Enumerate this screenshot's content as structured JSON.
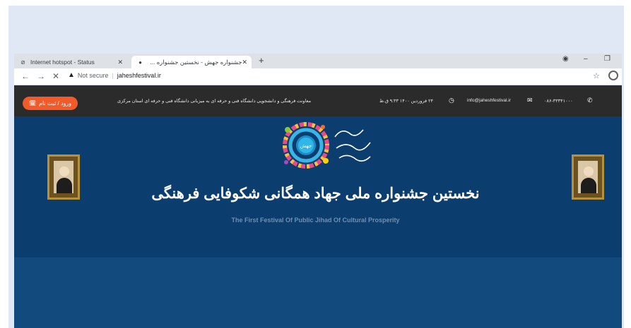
{
  "browser": {
    "tabs": [
      {
        "label": "Internet hotspot - Status",
        "icon": "hotspot-icon"
      },
      {
        "label": "جشنواره جهش - نخستین جشنواره ...",
        "icon": "site-icon"
      }
    ],
    "url_warning": "Not secure",
    "url": "jaheshfestival.ir"
  },
  "topbar": {
    "login_label": "ورود / ثبت نام",
    "org_text": "معاونت فرهنگی و دانشجویی دانشگاه فنی و حرفه ای به میزبانی دانشگاه فنی و حرفه ای استان مرکزی",
    "date_text": "۲۴ فروردین ۱۴۰۰ ۹:۳۳ ق.ظ",
    "email": "info@jaheshfestival.ir",
    "phone": "۰۸۶-۳۳۳۴۱۰۰۰"
  },
  "hero": {
    "title": "نخستین جشنواره ملی جهاد همگانی شکوفایی فرهنگی",
    "subtitle": "The First Festival Of Public Jihad Of Cultural Prosperity",
    "logo_text": "جهش"
  },
  "colors": {
    "accent": "#f25a2a",
    "hero_bg": "#0b3d6f",
    "topbar_bg": "#2b2b2b"
  }
}
